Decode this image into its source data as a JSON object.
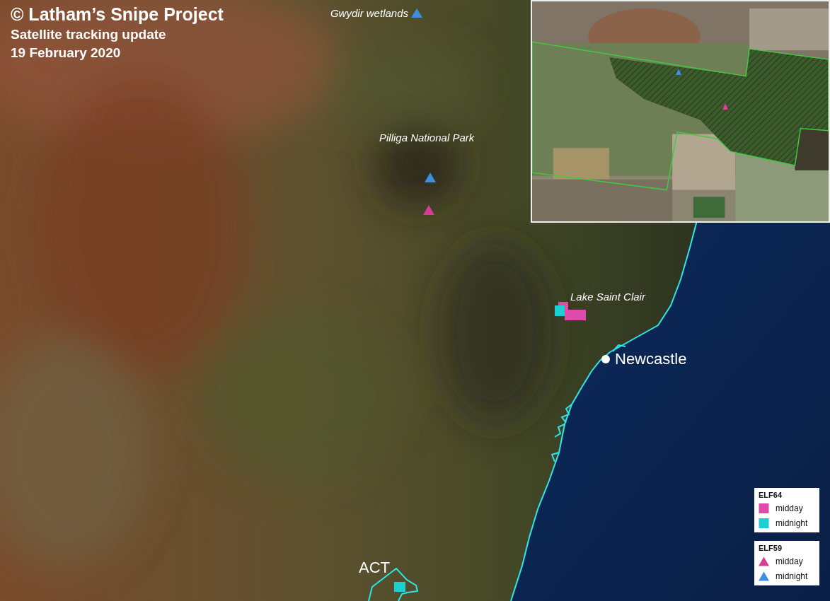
{
  "title": "© Latham’s Snipe Project",
  "subtitle": "Satellite tracking update",
  "date": "19 February 2020",
  "places": [
    {
      "name": "Gwydir wetlands",
      "kind": "area"
    },
    {
      "name": "Pilliga National Park",
      "kind": "area"
    },
    {
      "name": "Lake Saint Clair",
      "kind": "area"
    },
    {
      "name": "Newcastle",
      "kind": "city"
    },
    {
      "name": "ACT",
      "kind": "territory"
    }
  ],
  "markers": [
    {
      "kind": "triangle",
      "color": "#3d8fe0"
    },
    {
      "kind": "triangle",
      "color": "#3d8fe0"
    },
    {
      "kind": "triangle",
      "color": "#d63d97"
    },
    {
      "kind": "square",
      "color": "#e04aa8"
    },
    {
      "kind": "square",
      "color": "#1ccfd2"
    },
    {
      "kind": "square",
      "color": "#e04aa8"
    },
    {
      "kind": "square",
      "color": "#1ccfd2"
    }
  ],
  "inset": {
    "markers": [
      {
        "kind": "triangle",
        "color": "#3d8fe0"
      },
      {
        "kind": "triangle",
        "color": "#e03c9a"
      }
    ]
  },
  "legend": [
    {
      "title": "ELF64",
      "items": [
        {
          "label": "midday",
          "kind": "square",
          "color": "#e04aa8"
        },
        {
          "label": "midnight",
          "kind": "square",
          "color": "#1ccfd2"
        }
      ]
    },
    {
      "title": "ELF59",
      "items": [
        {
          "label": "midday",
          "kind": "triangle",
          "color": "#d63d97"
        },
        {
          "label": "midnight",
          "kind": "triangle",
          "color": "#3d8fe0"
        }
      ]
    }
  ]
}
